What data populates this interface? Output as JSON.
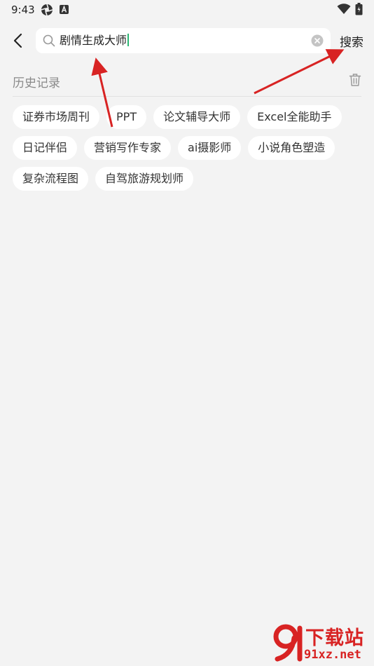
{
  "status_bar": {
    "time": "9:43"
  },
  "search": {
    "query": "剧情生成大师",
    "action_label": "搜索"
  },
  "history": {
    "title": "历史记录",
    "tags": [
      "证券市场周刊",
      "PPT",
      "论文辅导大师",
      "Excel全能助手",
      "日记伴侣",
      "营销写作专家",
      "ai摄影师",
      "小说角色塑造",
      "复杂流程图",
      "自驾旅游规划师"
    ]
  },
  "watermark": {
    "title": "下载站",
    "url": "91xz.net"
  },
  "colors": {
    "background": "#f3f3f3",
    "tag_background": "#ffffff",
    "caret": "#2bb673",
    "annotation_arrow": "#d82323"
  },
  "icons": {
    "back": "chevron-left-icon",
    "search": "search-icon",
    "clear": "clear-circle-icon",
    "trash": "trash-icon",
    "wifi": "wifi-icon",
    "battery": "battery-icon"
  }
}
